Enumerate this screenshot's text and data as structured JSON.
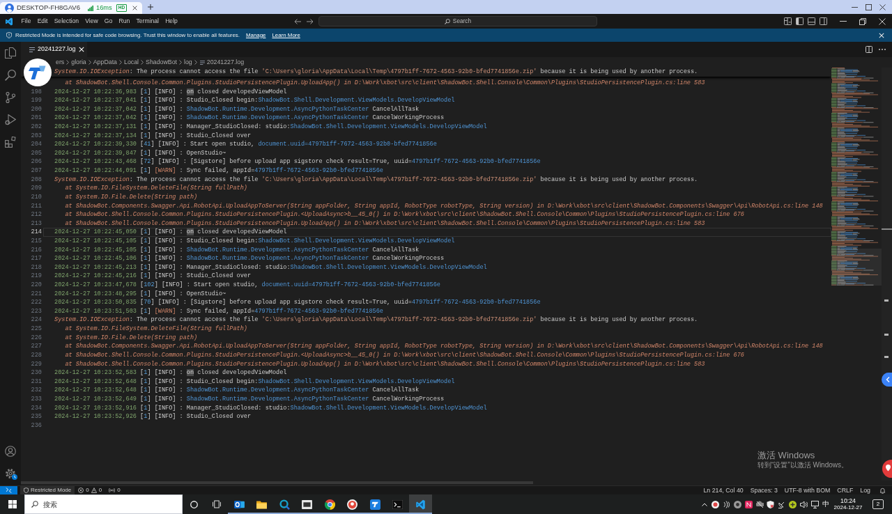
{
  "remote_desktop_tab": {
    "title": "DESKTOP-FH8GAV6",
    "latency": "16ms",
    "quality": "HD"
  },
  "title_bar": {
    "menu": [
      "File",
      "Edit",
      "Selection",
      "View",
      "Go",
      "Run",
      "Terminal",
      "Help"
    ],
    "command_center": "Search"
  },
  "banner": {
    "message": "Restricted Mode is intended for safe code browsing. Trust this window to enable all features.",
    "links": [
      "Manage",
      "Learn More"
    ]
  },
  "tabs": [
    {
      "label": "20241227.log",
      "selected": true
    }
  ],
  "breadcrumb": [
    "ers",
    "gloria",
    "AppData",
    "Local",
    "ShadowBot",
    "log",
    "20241227.log"
  ],
  "editor": {
    "sticky_line": {
      "parts": [
        {
          "text": "System.IO.IOException",
          "kind": "exception"
        },
        {
          "text": ": The process cannot access the file ",
          "kind": "plain"
        },
        {
          "text": "'C:\\Users\\gloria\\AppData\\Local\\Temp\\4797b1ff-7672-4563-92b0-bfed7741856e.zip'",
          "kind": "string"
        },
        {
          "text": " because it is being used by another process.",
          "kind": "plain"
        }
      ]
    },
    "lines": [
      {
        "current": false,
        "parts": [
          {
            "text": "   at ShadowBot.Shell.Console.Common.Plugins.StudioPersistencePlugin.UploadApp() in D:\\Work\\xbot\\src\\client\\ShadowBot.Shell.Console\\Common\\Plugins\\StudioPersistencePlugin.cs:line 583",
            "kind": "trace"
          }
        ]
      },
      {
        "number": "198",
        "current": false,
        "parts": [
          {
            "text": "2024-12-27 10:22:36,983",
            "kind": "date"
          },
          {
            "text": " [",
            "kind": "plain"
          },
          {
            "text": "1",
            "kind": "thread"
          },
          {
            "text": "] [INFO] : ",
            "kind": "plain"
          },
          {
            "text": "on",
            "kind": "match"
          },
          {
            "text": " closed developedViewModel",
            "kind": "plain"
          }
        ]
      },
      {
        "number": "199",
        "current": false,
        "parts": [
          {
            "text": "2024-12-27 10:22:37,041",
            "kind": "date"
          },
          {
            "text": " [",
            "kind": "plain"
          },
          {
            "text": "1",
            "kind": "thread"
          },
          {
            "text": "] [INFO] : Studio_Closed begin:",
            "kind": "plain"
          },
          {
            "text": "ShadowBot.Shell.Development.ViewModels.DevelopViewModel",
            "kind": "type"
          }
        ]
      },
      {
        "number": "200",
        "current": false,
        "parts": [
          {
            "text": "2024-12-27 10:22:37,042",
            "kind": "date"
          },
          {
            "text": " [",
            "kind": "plain"
          },
          {
            "text": "1",
            "kind": "thread"
          },
          {
            "text": "] [INFO] : ",
            "kind": "plain"
          },
          {
            "text": "ShadowBot.Runtime.Development.AsyncPythonTaskCenter",
            "kind": "type"
          },
          {
            "text": " CancelAllTask",
            "kind": "plain"
          }
        ]
      },
      {
        "number": "201",
        "current": false,
        "parts": [
          {
            "text": "2024-12-27 10:22:37,042",
            "kind": "date"
          },
          {
            "text": " [",
            "kind": "plain"
          },
          {
            "text": "1",
            "kind": "thread"
          },
          {
            "text": "] [INFO] : ",
            "kind": "plain"
          },
          {
            "text": "ShadowBot.Runtime.Development.AsyncPythonTaskCenter",
            "kind": "type"
          },
          {
            "text": " CancelWorkingProcess",
            "kind": "plain"
          }
        ]
      },
      {
        "number": "202",
        "current": false,
        "parts": [
          {
            "text": "2024-12-27 10:22:37,131",
            "kind": "date"
          },
          {
            "text": " [",
            "kind": "plain"
          },
          {
            "text": "1",
            "kind": "thread"
          },
          {
            "text": "] [INFO] : Manager_StudioClosed: studio:",
            "kind": "plain"
          },
          {
            "text": "ShadowBot.Shell.Development.ViewModels.DevelopViewModel",
            "kind": "type"
          }
        ]
      },
      {
        "number": "203",
        "current": false,
        "parts": [
          {
            "text": "2024-12-27 10:22:37,134",
            "kind": "date"
          },
          {
            "text": " [",
            "kind": "plain"
          },
          {
            "text": "1",
            "kind": "thread"
          },
          {
            "text": "] [INFO] : Studio_Closed over",
            "kind": "plain"
          }
        ]
      },
      {
        "number": "204",
        "current": false,
        "parts": [
          {
            "text": "2024-12-27 10:22:39,330",
            "kind": "date"
          },
          {
            "text": " [",
            "kind": "plain"
          },
          {
            "text": "41",
            "kind": "thread"
          },
          {
            "text": "] [INFO] : Start open studio, ",
            "kind": "plain"
          },
          {
            "text": "document.uuid=4797b1ff-7672-4563-92b0-bfed7741856e",
            "kind": "type"
          }
        ]
      },
      {
        "number": "205",
        "current": false,
        "parts": [
          {
            "text": "2024-12-27 10:22:39,847",
            "kind": "date"
          },
          {
            "text": " [",
            "kind": "plain"
          },
          {
            "text": "1",
            "kind": "thread"
          },
          {
            "text": "] [INFO] : OpenStudio~",
            "kind": "plain"
          }
        ]
      },
      {
        "number": "206",
        "current": false,
        "parts": [
          {
            "text": "2024-12-27 10:22:43,468",
            "kind": "date"
          },
          {
            "text": " [",
            "kind": "plain"
          },
          {
            "text": "72",
            "kind": "thread"
          },
          {
            "text": "] [INFO] : [Sigstore] before upload app sigstore check result=True, uuid=",
            "kind": "plain"
          },
          {
            "text": "4797b1ff-7672-4563-92b0-bfed7741856e",
            "kind": "type"
          }
        ]
      },
      {
        "number": "207",
        "current": false,
        "parts": [
          {
            "text": "2024-12-27 10:22:44,091",
            "kind": "date"
          },
          {
            "text": " [",
            "kind": "plain"
          },
          {
            "text": "1",
            "kind": "thread"
          },
          {
            "text": "] ",
            "kind": "plain"
          },
          {
            "text": "[WARN]",
            "kind": "level_warn"
          },
          {
            "text": " : Sync failed, appId=",
            "kind": "plain"
          },
          {
            "text": "4797b1ff-7672-4563-92b0-bfed7741856e",
            "kind": "type"
          }
        ]
      },
      {
        "number": "208",
        "current": false,
        "parts": [
          {
            "text": "System.IO.IOException",
            "kind": "exception"
          },
          {
            "text": ": The process cannot access the file ",
            "kind": "plain"
          },
          {
            "text": "'C:\\Users\\gloria\\AppData\\Local\\Temp\\4797b1ff-7672-4563-92b0-bfed7741856e.zip'",
            "kind": "string"
          },
          {
            "text": " because it is being used by another process.",
            "kind": "plain"
          }
        ]
      },
      {
        "number": "209",
        "current": false,
        "parts": [
          {
            "text": "   at System.IO.FileSystem.DeleteFile(String fullPath)",
            "kind": "trace"
          }
        ]
      },
      {
        "number": "210",
        "current": false,
        "parts": [
          {
            "text": "   at System.IO.File.Delete(String path)",
            "kind": "trace"
          }
        ]
      },
      {
        "number": "211",
        "current": false,
        "parts": [
          {
            "text": "   at ShadowBot.Components.Swagger.Api.RobotApi.UploadAppToServer(String appFolder, String appId, RobotType robotType, String version) in D:\\Work\\xbot\\src\\client\\ShadowBot.Components\\Swagger\\Api\\RobotApi.cs:line 148",
            "kind": "trace"
          }
        ]
      },
      {
        "number": "212",
        "current": false,
        "parts": [
          {
            "text": "   at ShadowBot.Shell.Console.Common.Plugins.StudioPersistencePlugin.<UploadAsync>b__45_0() in D:\\Work\\xbot\\src\\client\\ShadowBot.Shell.Console\\Common\\Plugins\\StudioPersistencePlugin.cs:line 676",
            "kind": "trace"
          }
        ]
      },
      {
        "number": "213",
        "current": false,
        "parts": [
          {
            "text": "   at ShadowBot.Shell.Console.Common.Plugins.StudioPersistencePlugin.UploadApp() in D:\\Work\\xbot\\src\\client\\ShadowBot.Shell.Console\\Common\\Plugins\\StudioPersistencePlugin.cs:line 583",
            "kind": "trace"
          }
        ]
      },
      {
        "number": "214",
        "current": true,
        "parts": [
          {
            "text": "2024-12-27 10:22:45,050",
            "kind": "date"
          },
          {
            "text": " [",
            "kind": "plain"
          },
          {
            "text": "1",
            "kind": "thread"
          },
          {
            "text": "] [INFO] : ",
            "kind": "plain"
          },
          {
            "text": "on",
            "kind": "match"
          },
          {
            "text": " closed developedViewModel",
            "kind": "plain"
          }
        ]
      },
      {
        "number": "215",
        "current": false,
        "parts": [
          {
            "text": "2024-12-27 10:22:45,105",
            "kind": "date"
          },
          {
            "text": " [",
            "kind": "plain"
          },
          {
            "text": "1",
            "kind": "thread"
          },
          {
            "text": "] [INFO] : Studio_Closed begin:",
            "kind": "plain"
          },
          {
            "text": "ShadowBot.Shell.Development.ViewModels.DevelopViewModel",
            "kind": "type"
          }
        ]
      },
      {
        "number": "216",
        "current": false,
        "parts": [
          {
            "text": "2024-12-27 10:22:45,105",
            "kind": "date"
          },
          {
            "text": " [",
            "kind": "plain"
          },
          {
            "text": "1",
            "kind": "thread"
          },
          {
            "text": "] [INFO] : ",
            "kind": "plain"
          },
          {
            "text": "ShadowBot.Runtime.Development.AsyncPythonTaskCenter",
            "kind": "type"
          },
          {
            "text": " CancelAllTask",
            "kind": "plain"
          }
        ]
      },
      {
        "number": "217",
        "current": false,
        "parts": [
          {
            "text": "2024-12-27 10:22:45,106",
            "kind": "date"
          },
          {
            "text": " [",
            "kind": "plain"
          },
          {
            "text": "1",
            "kind": "thread"
          },
          {
            "text": "] [INFO] : ",
            "kind": "plain"
          },
          {
            "text": "ShadowBot.Runtime.Development.AsyncPythonTaskCenter",
            "kind": "type"
          },
          {
            "text": " CancelWorkingProcess",
            "kind": "plain"
          }
        ]
      },
      {
        "number": "218",
        "current": false,
        "parts": [
          {
            "text": "2024-12-27 10:22:45,213",
            "kind": "date"
          },
          {
            "text": " [",
            "kind": "plain"
          },
          {
            "text": "1",
            "kind": "thread"
          },
          {
            "text": "] [INFO] : Manager_StudioClosed: studio:",
            "kind": "plain"
          },
          {
            "text": "ShadowBot.Shell.Development.ViewModels.DevelopViewModel",
            "kind": "type"
          }
        ]
      },
      {
        "number": "219",
        "current": false,
        "parts": [
          {
            "text": "2024-12-27 10:22:45,216",
            "kind": "date"
          },
          {
            "text": " [",
            "kind": "plain"
          },
          {
            "text": "1",
            "kind": "thread"
          },
          {
            "text": "] [INFO] : Studio_Closed over",
            "kind": "plain"
          }
        ]
      },
      {
        "number": "220",
        "current": false,
        "parts": [
          {
            "text": "2024-12-27 10:23:47,678",
            "kind": "date"
          },
          {
            "text": " [",
            "kind": "plain"
          },
          {
            "text": "102",
            "kind": "thread"
          },
          {
            "text": "] [INFO] : Start open studio, ",
            "kind": "plain"
          },
          {
            "text": "document.uuid=4797b1ff-7672-4563-92b0-bfed7741856e",
            "kind": "type"
          }
        ]
      },
      {
        "number": "221",
        "current": false,
        "parts": [
          {
            "text": "2024-12-27 10:23:48,295",
            "kind": "date"
          },
          {
            "text": " [",
            "kind": "plain"
          },
          {
            "text": "1",
            "kind": "thread"
          },
          {
            "text": "] [INFO] : OpenStudio~",
            "kind": "plain"
          }
        ]
      },
      {
        "number": "222",
        "current": false,
        "parts": [
          {
            "text": "2024-12-27 10:23:50,835",
            "kind": "date"
          },
          {
            "text": " [",
            "kind": "plain"
          },
          {
            "text": "70",
            "kind": "thread"
          },
          {
            "text": "] [INFO] : [Sigstore] before upload app sigstore check result=True, uuid=",
            "kind": "plain"
          },
          {
            "text": "4797b1ff-7672-4563-92b0-bfed7741856e",
            "kind": "type"
          }
        ]
      },
      {
        "number": "223",
        "current": false,
        "parts": [
          {
            "text": "2024-12-27 10:23:51,503",
            "kind": "date"
          },
          {
            "text": " [",
            "kind": "plain"
          },
          {
            "text": "1",
            "kind": "thread"
          },
          {
            "text": "] ",
            "kind": "plain"
          },
          {
            "text": "[WARN]",
            "kind": "level_warn"
          },
          {
            "text": " : Sync failed, appId=",
            "kind": "plain"
          },
          {
            "text": "4797b1ff-7672-4563-92b0-bfed7741856e",
            "kind": "type"
          }
        ]
      },
      {
        "number": "224",
        "current": false,
        "parts": [
          {
            "text": "System.IO.IOException",
            "kind": "exception"
          },
          {
            "text": ": The process cannot access the file ",
            "kind": "plain"
          },
          {
            "text": "'C:\\Users\\gloria\\AppData\\Local\\Temp\\4797b1ff-7672-4563-92b0-bfed7741856e.zip'",
            "kind": "string"
          },
          {
            "text": " because it is being used by another process.",
            "kind": "plain"
          }
        ]
      },
      {
        "number": "225",
        "current": false,
        "parts": [
          {
            "text": "   at System.IO.FileSystem.DeleteFile(String fullPath)",
            "kind": "trace"
          }
        ]
      },
      {
        "number": "226",
        "current": false,
        "parts": [
          {
            "text": "   at System.IO.File.Delete(String path)",
            "kind": "trace"
          }
        ]
      },
      {
        "number": "227",
        "current": false,
        "parts": [
          {
            "text": "   at ShadowBot.Components.Swagger.Api.RobotApi.UploadAppToServer(String appFolder, String appId, RobotType robotType, String version) in D:\\Work\\xbot\\src\\client\\ShadowBot.Components\\Swagger\\Api\\RobotApi.cs:line 148",
            "kind": "trace"
          }
        ]
      },
      {
        "number": "228",
        "current": false,
        "parts": [
          {
            "text": "   at ShadowBot.Shell.Console.Common.Plugins.StudioPersistencePlugin.<UploadAsync>b__45_0() in D:\\Work\\xbot\\src\\client\\ShadowBot.Shell.Console\\Common\\Plugins\\StudioPersistencePlugin.cs:line 676",
            "kind": "trace"
          }
        ]
      },
      {
        "number": "229",
        "current": false,
        "parts": [
          {
            "text": "   at ShadowBot.Shell.Console.Common.Plugins.StudioPersistencePlugin.UploadApp() in D:\\Work\\xbot\\src\\client\\ShadowBot.Shell.Console\\Common\\Plugins\\StudioPersistencePlugin.cs:line 583",
            "kind": "trace"
          }
        ]
      },
      {
        "number": "230",
        "current": false,
        "parts": [
          {
            "text": "2024-12-27 10:23:52,583",
            "kind": "date"
          },
          {
            "text": " [",
            "kind": "plain"
          },
          {
            "text": "1",
            "kind": "thread"
          },
          {
            "text": "] [INFO] : ",
            "kind": "plain"
          },
          {
            "text": "on",
            "kind": "match"
          },
          {
            "text": " closed developedViewModel",
            "kind": "plain"
          }
        ]
      },
      {
        "number": "231",
        "current": false,
        "parts": [
          {
            "text": "2024-12-27 10:23:52,648",
            "kind": "date"
          },
          {
            "text": " [",
            "kind": "plain"
          },
          {
            "text": "1",
            "kind": "thread"
          },
          {
            "text": "] [INFO] : Studio_Closed begin:",
            "kind": "plain"
          },
          {
            "text": "ShadowBot.Shell.Development.ViewModels.DevelopViewModel",
            "kind": "type"
          }
        ]
      },
      {
        "number": "232",
        "current": false,
        "parts": [
          {
            "text": "2024-12-27 10:23:52,648",
            "kind": "date"
          },
          {
            "text": " [",
            "kind": "plain"
          },
          {
            "text": "1",
            "kind": "thread"
          },
          {
            "text": "] [INFO] : ",
            "kind": "plain"
          },
          {
            "text": "ShadowBot.Runtime.Development.AsyncPythonTaskCenter",
            "kind": "type"
          },
          {
            "text": " CancelAllTask",
            "kind": "plain"
          }
        ]
      },
      {
        "number": "233",
        "current": false,
        "parts": [
          {
            "text": "2024-12-27 10:23:52,649",
            "kind": "date"
          },
          {
            "text": " [",
            "kind": "plain"
          },
          {
            "text": "1",
            "kind": "thread"
          },
          {
            "text": "] [INFO] : ",
            "kind": "plain"
          },
          {
            "text": "ShadowBot.Runtime.Development.AsyncPythonTaskCenter",
            "kind": "type"
          },
          {
            "text": " CancelWorkingProcess",
            "kind": "plain"
          }
        ]
      },
      {
        "number": "234",
        "current": false,
        "parts": [
          {
            "text": "2024-12-27 10:23:52,916",
            "kind": "date"
          },
          {
            "text": " [",
            "kind": "plain"
          },
          {
            "text": "1",
            "kind": "thread"
          },
          {
            "text": "] [INFO] : Manager_StudioClosed: studio:",
            "kind": "plain"
          },
          {
            "text": "ShadowBot.Shell.Development.ViewModels.DevelopViewModel",
            "kind": "type"
          }
        ]
      },
      {
        "number": "235",
        "current": false,
        "parts": [
          {
            "text": "2024-12-27 10:23:52,926",
            "kind": "date"
          },
          {
            "text": " [",
            "kind": "plain"
          },
          {
            "text": "1",
            "kind": "thread"
          },
          {
            "text": "] [INFO] : Studio_Closed over",
            "kind": "plain"
          }
        ]
      },
      {
        "number": "236",
        "current": false
      }
    ]
  },
  "activation_notice": {
    "title": "激活 Windows",
    "message": "转到“设置”以激活 Windows。"
  },
  "status_bar": {
    "restricted_mode": "Restricted Mode",
    "errors": "0",
    "warnings": "0",
    "ports": "0",
    "cursor_position": "Ln 214, Col 40",
    "indentation": "Spaces: 3",
    "encoding": "UTF-8 with BOM",
    "line_ending": "CRLF",
    "language": "Log"
  },
  "taskbar": {
    "search": {
      "placeholder": "搜索"
    },
    "apps": [
      {
        "kind": "mail",
        "running": true,
        "selected": false
      },
      {
        "kind": "folder",
        "running": true,
        "selected": false
      },
      {
        "kind": "ring_app",
        "running": true,
        "selected": false
      },
      {
        "kind": "photo_tile",
        "running": true,
        "selected": false
      },
      {
        "kind": "browser",
        "running": true,
        "selected": false
      },
      {
        "kind": "circle_app",
        "running": true,
        "selected": false
      },
      {
        "kind": "tile_app",
        "running": true,
        "selected": false
      },
      {
        "kind": "terminal",
        "running": true,
        "selected": false
      },
      {
        "kind": "code_editor",
        "running": true,
        "selected": true
      }
    ],
    "tray": {
      "input_method": "中",
      "time": "10:24",
      "date": "2024-12-27",
      "notification_count": "2"
    }
  }
}
